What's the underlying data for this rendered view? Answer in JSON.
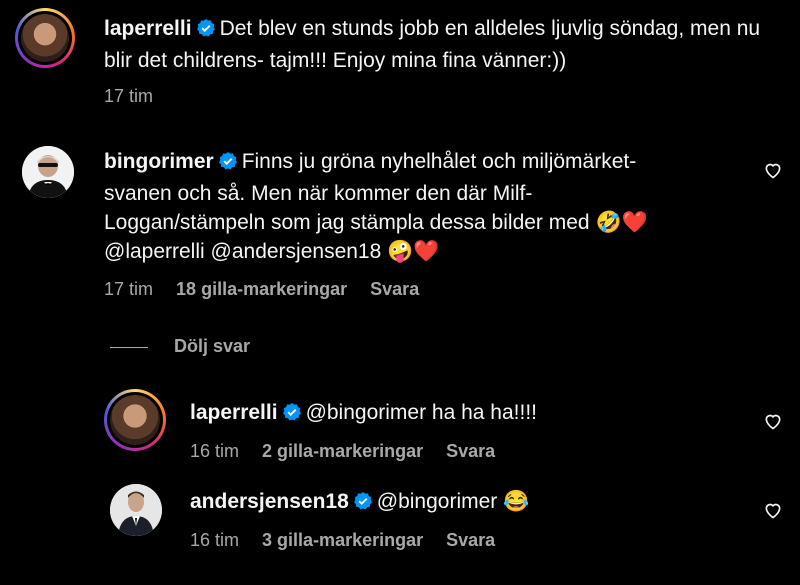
{
  "comments": [
    {
      "username": "laperrelli",
      "text": "Det blev en stunds jobb en alldeles ljuvlig söndag, men nu blir det childrens- tajm!!! Enjoy mina fina vänner:))",
      "time": "17 tim"
    },
    {
      "username": "bingorimer",
      "text_line1": "Finns ju gröna nyhelhålet och miljömärket-",
      "text_line2": "svanen och så. Men när kommer den där Milf-",
      "text_line3": "Loggan/stämpeln som jag stämpla dessa bilder med 🤣❤️",
      "text_line4": "@laperrelli @andersjensen18 🤪❤️",
      "time": "17 tim",
      "likes": "18 gilla-markeringar",
      "reply": "Svara"
    }
  ],
  "hide_replies": "Dölj svar",
  "replies": [
    {
      "username": "laperrelli",
      "text": "@bingorimer ha ha ha!!!!",
      "time": "16 tim",
      "likes": "2 gilla-markeringar",
      "reply": "Svara"
    },
    {
      "username": "andersjensen18",
      "text": "@bingorimer 😂",
      "time": "16 tim",
      "likes": "3 gilla-markeringar",
      "reply": "Svara"
    }
  ],
  "colors": {
    "background": "#000000",
    "text": "#f5f5f5",
    "muted": "#a8a8a8",
    "verified": "#0095f6"
  },
  "icons": {
    "verified": "verified-badge-icon",
    "like": "heart-icon"
  }
}
